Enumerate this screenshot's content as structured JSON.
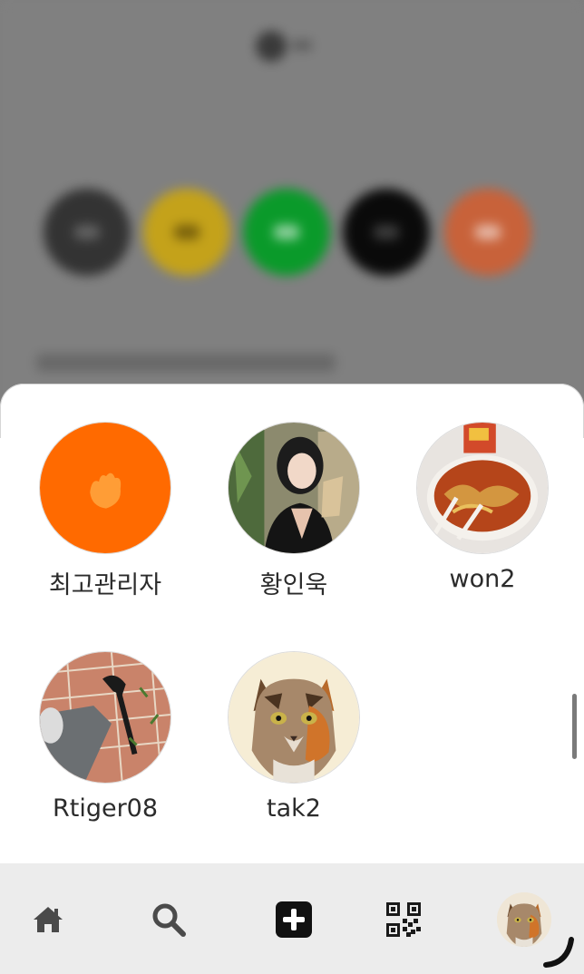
{
  "friends": [
    {
      "name": "최고관리자",
      "avatar": "orange-flame-avatar"
    },
    {
      "name": "황인욱",
      "avatar": "portrait-photo-avatar"
    },
    {
      "name": "won2",
      "avatar": "noodle-soup-photo-avatar"
    },
    {
      "name": "Rtiger08",
      "avatar": "brick-floor-photo-avatar"
    },
    {
      "name": "tak2",
      "avatar": "cat-illustration-avatar"
    }
  ],
  "nav": {
    "items": [
      {
        "id": "home",
        "icon": "home-icon"
      },
      {
        "id": "search",
        "icon": "search-icon"
      },
      {
        "id": "add",
        "icon": "plus-square-icon"
      },
      {
        "id": "qr",
        "icon": "qr-code-icon"
      },
      {
        "id": "profile",
        "icon": "profile-avatar"
      }
    ]
  },
  "colors": {
    "accent_orange": "#ff6a00",
    "overlay": "#808080",
    "nav_background": "#ececec"
  }
}
